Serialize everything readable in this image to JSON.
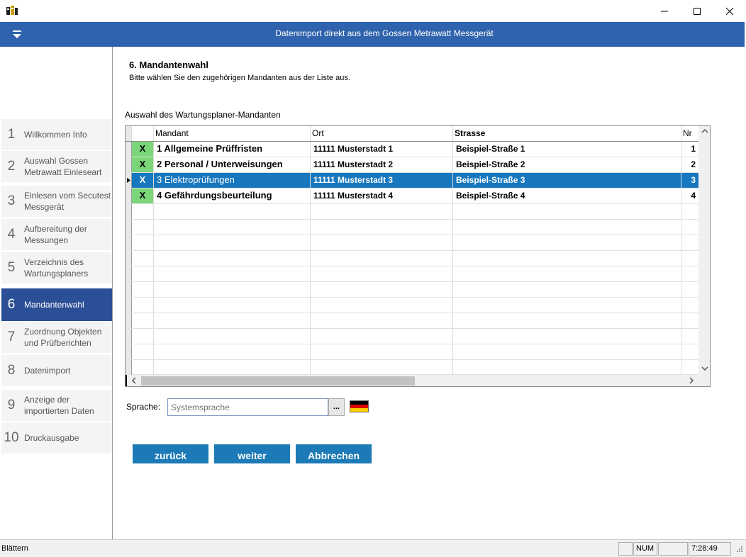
{
  "window": {
    "title": "Datenimport direkt aus dem Gossen Metrawatt Messgerät"
  },
  "colors": {
    "banner": "#2f63ad",
    "active_step": "#2b4f96",
    "selected_row": "#1777bf",
    "check_bg": "#7ad679",
    "button": "#1c7ab6"
  },
  "steps": [
    {
      "num": "1",
      "label": "Willkommen Info"
    },
    {
      "num": "2",
      "label": "Auswahl Gossen Metrawatt Einleseart"
    },
    {
      "num": "3",
      "label": "Einlesen vom Secutest Messgerät"
    },
    {
      "num": "4",
      "label": "Aufbereitung der Messungen"
    },
    {
      "num": "5",
      "label": "Verzeichnis des Wartungsplaners"
    },
    {
      "num": "6",
      "label": "Mandantenwahl"
    },
    {
      "num": "7",
      "label": "Zuordnung Objekten und Prüfberichten"
    },
    {
      "num": "8",
      "label": "Datenimport"
    },
    {
      "num": "9",
      "label": "Anzeige der importierten Daten"
    },
    {
      "num": "10",
      "label": "Druckausgabe"
    }
  ],
  "page": {
    "title": "6. Mandantenwahl",
    "subtitle": "Bitte wählen Sie den zugehörigen Mandanten aus der Liste aus.",
    "grid_caption": "Auswahl des Wartungsplaner-Mandanten"
  },
  "grid": {
    "columns": [
      "Mandant",
      "Ort",
      "Strasse",
      "Nr"
    ],
    "rows": [
      {
        "check": "X",
        "mandant": "1 Allgemeine Prüffristen",
        "ort": "11111 Musterstadt 1",
        "strasse": "Beispiel-Straße 1",
        "nr": "1"
      },
      {
        "check": "X",
        "mandant": "2 Personal / Unterweisungen",
        "ort": "11111 Musterstadt 2",
        "strasse": "Beispiel-Straße 2",
        "nr": "2"
      },
      {
        "check": "X",
        "mandant": "3 Elektroprüfungen",
        "ort": "11111 Musterstadt 3",
        "strasse": "Beispiel-Straße 3",
        "nr": "3"
      },
      {
        "check": "X",
        "mandant": "4 Gefährdungsbeurteilung",
        "ort": "11111 Musterstadt 4",
        "strasse": "Beispiel-Straße 4",
        "nr": "4"
      }
    ]
  },
  "language": {
    "label": "Sprache:",
    "placeholder": "Systemsprache",
    "browse": "..."
  },
  "buttons": {
    "back": "zurück",
    "next": "weiter",
    "cancel": "Abbrechen"
  },
  "status": {
    "text": "Blättern",
    "num": "NUM",
    "time": "7:28:49"
  }
}
